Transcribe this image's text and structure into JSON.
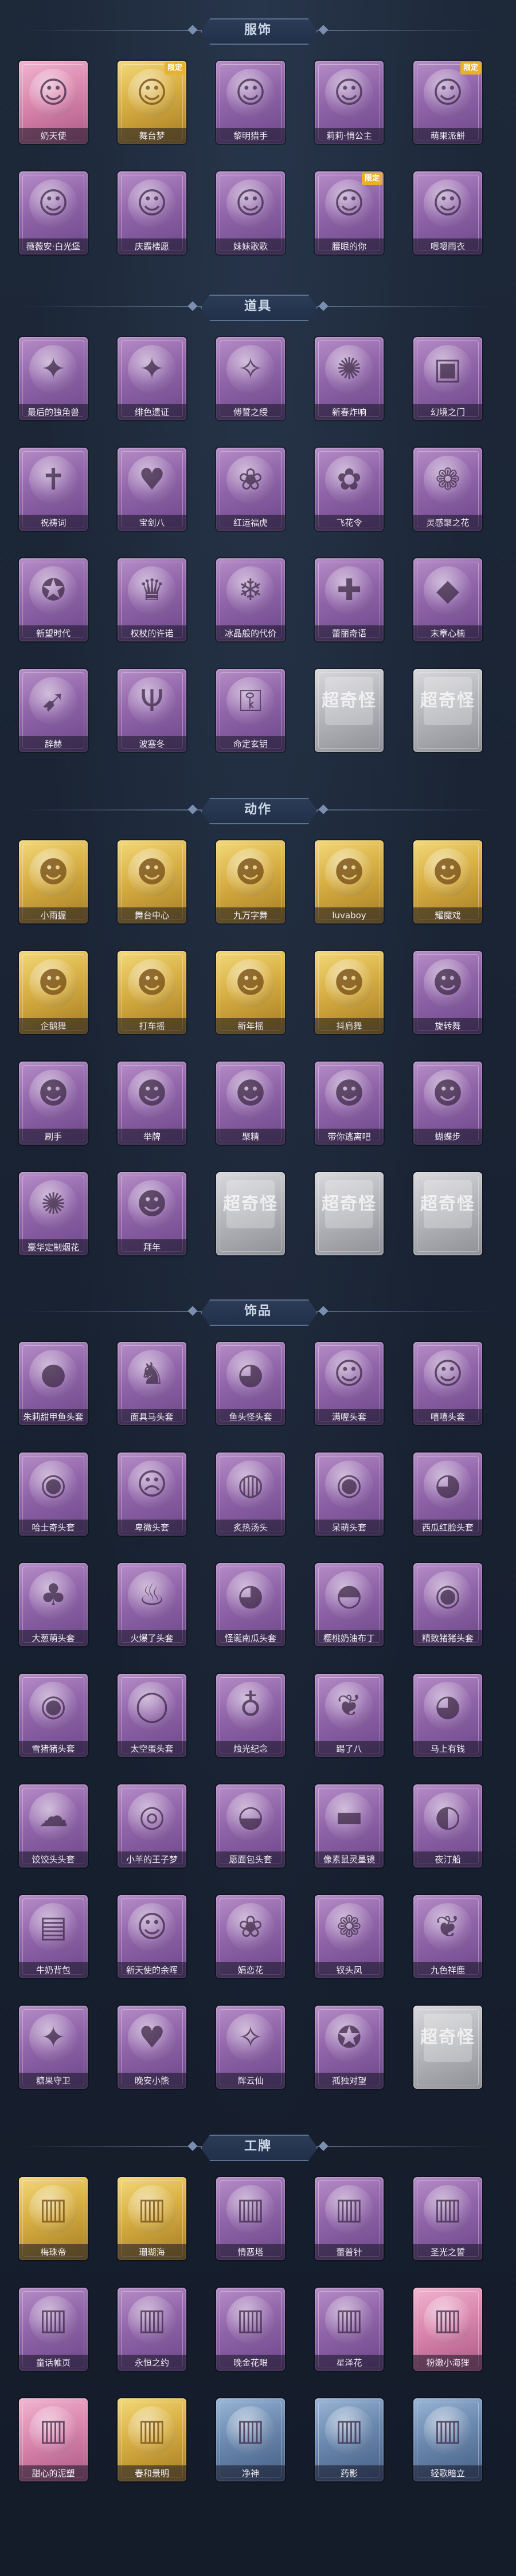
{
  "sections": [
    {
      "title": "服饰",
      "items": [
        {
          "label": "奶天使",
          "theme": "pink",
          "icon": "angel-portrait-icon",
          "glyph": "☺",
          "badge": ""
        },
        {
          "label": "舞台梦",
          "theme": "gold",
          "icon": "dancer-portrait-icon",
          "glyph": "☺",
          "badge": "限定"
        },
        {
          "label": "黎明猎手",
          "theme": "purple",
          "icon": "hunter-portrait-icon",
          "glyph": "☺",
          "badge": ""
        },
        {
          "label": "莉莉·悄公主",
          "theme": "purple",
          "icon": "princess-portrait-icon",
          "glyph": "☺",
          "badge": ""
        },
        {
          "label": "萌果派餅",
          "theme": "purple",
          "icon": "pie-portrait-icon",
          "glyph": "☺",
          "badge": "限定"
        },
        {
          "label": "薇薇安·白光堡",
          "theme": "purple",
          "icon": "castle-portrait-icon",
          "glyph": "☺",
          "badge": ""
        },
        {
          "label": "庆霸楼愿",
          "theme": "purple",
          "icon": "celebration-portrait-icon",
          "glyph": "☺",
          "badge": ""
        },
        {
          "label": "妹妹歌歌",
          "theme": "purple",
          "icon": "singer-portrait-icon",
          "glyph": "☺",
          "badge": ""
        },
        {
          "label": "腰眼的你",
          "theme": "purple",
          "icon": "witch-portrait-icon",
          "glyph": "☺",
          "badge": "限定"
        },
        {
          "label": "嗯嗯雨衣",
          "theme": "purple",
          "icon": "raincoat-portrait-icon",
          "glyph": "☺",
          "badge": ""
        }
      ]
    },
    {
      "title": "道具",
      "items": [
        {
          "label": "最后的独角兽",
          "theme": "purple",
          "icon": "unicorn-wand-icon",
          "glyph": "✦",
          "badge": ""
        },
        {
          "label": "绯色遗证",
          "theme": "purple",
          "icon": "scarlet-rod-icon",
          "glyph": "✦",
          "badge": ""
        },
        {
          "label": "傅誓之绶",
          "theme": "purple",
          "icon": "ribbon-icon",
          "glyph": "✧",
          "badge": ""
        },
        {
          "label": "新春炸响",
          "theme": "purple",
          "icon": "firecracker-icon",
          "glyph": "✺",
          "badge": ""
        },
        {
          "label": "幻境之门",
          "theme": "purple",
          "icon": "portal-icon",
          "glyph": "▣",
          "badge": ""
        },
        {
          "label": "祝祷词",
          "theme": "purple",
          "icon": "cross-staff-icon",
          "glyph": "✝",
          "badge": ""
        },
        {
          "label": "宝剑八",
          "theme": "purple",
          "icon": "heart-mirror-icon",
          "glyph": "♥",
          "badge": ""
        },
        {
          "label": "红运福虎",
          "theme": "purple",
          "icon": "tiger-lantern-icon",
          "glyph": "❀",
          "badge": ""
        },
        {
          "label": "飞花令",
          "theme": "purple",
          "icon": "flower-bouquet-icon",
          "glyph": "✿",
          "badge": ""
        },
        {
          "label": "灵感聚之花",
          "theme": "purple",
          "icon": "bloom-icon",
          "glyph": "❁",
          "badge": ""
        },
        {
          "label": "新望时代",
          "theme": "purple",
          "icon": "revolver-icon",
          "glyph": "✪",
          "badge": ""
        },
        {
          "label": "权杖的许诺",
          "theme": "purple",
          "icon": "scepter-icon",
          "glyph": "♛",
          "badge": ""
        },
        {
          "label": "冰晶般的代价",
          "theme": "purple",
          "icon": "ice-flower-icon",
          "glyph": "❄",
          "badge": ""
        },
        {
          "label": "蕾丽奇语",
          "theme": "purple",
          "icon": "medical-box-icon",
          "glyph": "✚",
          "badge": ""
        },
        {
          "label": "末章心楠",
          "theme": "purple",
          "icon": "lantern-icon",
          "glyph": "◆",
          "badge": ""
        },
        {
          "label": "辞赫",
          "theme": "purple",
          "icon": "spear-icon",
          "glyph": "➹",
          "badge": ""
        },
        {
          "label": "波塞冬",
          "theme": "purple",
          "icon": "trident-icon",
          "glyph": "Ψ",
          "badge": ""
        },
        {
          "label": "命定玄钥",
          "theme": "purple",
          "icon": "key-charm-icon",
          "glyph": "⚿",
          "badge": ""
        },
        {
          "label": "",
          "theme": "grey",
          "icon": "locked-placeholder-icon",
          "glyph": "超奇怪",
          "badge": ""
        },
        {
          "label": "",
          "theme": "grey",
          "icon": "locked-placeholder-icon",
          "glyph": "超奇怪",
          "badge": ""
        }
      ]
    },
    {
      "title": "动作",
      "items": [
        {
          "label": "小雨握",
          "theme": "gold",
          "icon": "emote-figure-icon",
          "glyph": "☻",
          "badge": ""
        },
        {
          "label": "舞台中心",
          "theme": "gold",
          "icon": "emote-figure-icon",
          "glyph": "☻",
          "badge": ""
        },
        {
          "label": "九万字舞",
          "theme": "gold",
          "icon": "emote-figure-icon",
          "glyph": "☻",
          "badge": ""
        },
        {
          "label": "luvaboy",
          "theme": "gold",
          "icon": "emote-figure-icon",
          "glyph": "☻",
          "badge": ""
        },
        {
          "label": "耀魔戏",
          "theme": "gold",
          "icon": "emote-figure-icon",
          "glyph": "☻",
          "badge": ""
        },
        {
          "label": "企鹅舞",
          "theme": "gold",
          "icon": "emote-figure-icon",
          "glyph": "☻",
          "badge": ""
        },
        {
          "label": "打车摇",
          "theme": "gold",
          "icon": "emote-figure-icon",
          "glyph": "☻",
          "badge": ""
        },
        {
          "label": "新年摇",
          "theme": "gold",
          "icon": "emote-figure-icon",
          "glyph": "☻",
          "badge": ""
        },
        {
          "label": "抖肩舞",
          "theme": "gold",
          "icon": "emote-figure-icon",
          "glyph": "☻",
          "badge": ""
        },
        {
          "label": "旋转舞",
          "theme": "purple",
          "icon": "emote-figure-icon",
          "glyph": "☻",
          "badge": ""
        },
        {
          "label": "刷手",
          "theme": "purple",
          "icon": "emote-figure-icon",
          "glyph": "☻",
          "badge": ""
        },
        {
          "label": "举牌",
          "theme": "purple",
          "icon": "emote-figure-icon",
          "glyph": "☻",
          "badge": ""
        },
        {
          "label": "聚精",
          "theme": "purple",
          "icon": "emote-figure-icon",
          "glyph": "☻",
          "badge": ""
        },
        {
          "label": "带你逃离吧",
          "theme": "purple",
          "icon": "emote-figure-icon",
          "glyph": "☻",
          "badge": ""
        },
        {
          "label": "蝴蝶步",
          "theme": "purple",
          "icon": "emote-figure-icon",
          "glyph": "☻",
          "badge": ""
        },
        {
          "label": "豪华定制烟花",
          "theme": "purple",
          "icon": "fireworks-icon",
          "glyph": "✺",
          "badge": ""
        },
        {
          "label": "拜年",
          "theme": "purple",
          "icon": "emote-figure-icon",
          "glyph": "☻",
          "badge": ""
        },
        {
          "label": "",
          "theme": "grey",
          "icon": "locked-placeholder-icon",
          "glyph": "超奇怪",
          "badge": ""
        },
        {
          "label": "",
          "theme": "grey",
          "icon": "locked-placeholder-icon",
          "glyph": "超奇怪",
          "badge": ""
        },
        {
          "label": "",
          "theme": "grey",
          "icon": "locked-placeholder-icon",
          "glyph": "超奇怪",
          "badge": ""
        }
      ]
    },
    {
      "title": "饰品",
      "items": [
        {
          "label": "朱莉甜甲鱼头套",
          "theme": "purple",
          "icon": "mask-head-icon",
          "glyph": "●",
          "badge": ""
        },
        {
          "label": "面具马头套",
          "theme": "purple",
          "icon": "horse-head-icon",
          "glyph": "♞",
          "badge": ""
        },
        {
          "label": "鱼头怪头套",
          "theme": "purple",
          "icon": "fish-head-icon",
          "glyph": "◕",
          "badge": ""
        },
        {
          "label": "满喔头套",
          "theme": "purple",
          "icon": "smiley-head-icon",
          "glyph": "☺",
          "badge": ""
        },
        {
          "label": "嘻嘻头套",
          "theme": "purple",
          "icon": "grin-head-icon",
          "glyph": "☺",
          "badge": ""
        },
        {
          "label": "哈士奇头套",
          "theme": "purple",
          "icon": "husky-head-icon",
          "glyph": "◉",
          "badge": ""
        },
        {
          "label": "卑微头套",
          "theme": "purple",
          "icon": "sad-head-icon",
          "glyph": "☹",
          "badge": ""
        },
        {
          "label": "炙热汤头",
          "theme": "purple",
          "icon": "hot-pot-head-icon",
          "glyph": "◍",
          "badge": ""
        },
        {
          "label": "呆萌头套",
          "theme": "purple",
          "icon": "dumb-face-head-icon",
          "glyph": "◉",
          "badge": ""
        },
        {
          "label": "西瓜红脸头套",
          "theme": "purple",
          "icon": "pikachu-head-icon",
          "glyph": "◕",
          "badge": ""
        },
        {
          "label": "大葱萌头套",
          "theme": "purple",
          "icon": "scallion-head-icon",
          "glyph": "♣",
          "badge": ""
        },
        {
          "label": "火爆了头套",
          "theme": "purple",
          "icon": "fire-head-icon",
          "glyph": "♨",
          "badge": ""
        },
        {
          "label": "怪诞南瓜头套",
          "theme": "purple",
          "icon": "pumpkin-head-icon",
          "glyph": "◕",
          "badge": ""
        },
        {
          "label": "樱桃奶油布丁",
          "theme": "purple",
          "icon": "pudding-head-icon",
          "glyph": "◓",
          "badge": ""
        },
        {
          "label": "精致猪猪头套",
          "theme": "purple",
          "icon": "pig-head-icon",
          "glyph": "◉",
          "badge": ""
        },
        {
          "label": "雪猪猪头套",
          "theme": "purple",
          "icon": "snow-pig-head-icon",
          "glyph": "◉",
          "badge": ""
        },
        {
          "label": "太空蛋头套",
          "theme": "purple",
          "icon": "egg-head-icon",
          "glyph": "◯",
          "badge": ""
        },
        {
          "label": "烛光纪念",
          "theme": "purple",
          "icon": "candle-head-icon",
          "glyph": "♁",
          "badge": ""
        },
        {
          "label": "踢了八",
          "theme": "purple",
          "icon": "garlic-head-icon",
          "glyph": "❦",
          "badge": ""
        },
        {
          "label": "马上有钱",
          "theme": "purple",
          "icon": "lucky-head-icon",
          "glyph": "◕",
          "badge": ""
        },
        {
          "label": "饺饺头头套",
          "theme": "purple",
          "icon": "dumpling-head-icon",
          "glyph": "☁",
          "badge": ""
        },
        {
          "label": "小羊的王子梦",
          "theme": "purple",
          "icon": "lamb-head-icon",
          "glyph": "◎",
          "badge": ""
        },
        {
          "label": "愿面包头套",
          "theme": "purple",
          "icon": "bread-head-icon",
          "glyph": "◒",
          "badge": ""
        },
        {
          "label": "像素鼠灵墨镜",
          "theme": "purple",
          "icon": "pixel-sunglasses-icon",
          "glyph": "▬",
          "badge": ""
        },
        {
          "label": "夜汀船",
          "theme": "purple",
          "icon": "night-boat-icon",
          "glyph": "◐",
          "badge": ""
        },
        {
          "label": "牛奶背包",
          "theme": "purple",
          "icon": "milk-backpack-icon",
          "glyph": "▤",
          "badge": ""
        },
        {
          "label": "新天使的余晖",
          "theme": "purple",
          "icon": "angel-doll-icon",
          "glyph": "☺",
          "badge": ""
        },
        {
          "label": "娟恋花",
          "theme": "purple",
          "icon": "flower-pendant-icon",
          "glyph": "❀",
          "badge": ""
        },
        {
          "label": "钗头凤",
          "theme": "purple",
          "icon": "phoenix-hairpin-icon",
          "glyph": "❁",
          "badge": ""
        },
        {
          "label": "九色祥鹿",
          "theme": "purple",
          "icon": "deer-ornament-icon",
          "glyph": "❦",
          "badge": ""
        },
        {
          "label": "糖果守卫",
          "theme": "purple",
          "icon": "candy-guard-icon",
          "glyph": "✦",
          "badge": ""
        },
        {
          "label": "晚安小熊",
          "theme": "purple",
          "icon": "bear-doll-icon",
          "glyph": "♥",
          "badge": ""
        },
        {
          "label": "辉云仙",
          "theme": "purple",
          "icon": "cloud-fairy-icon",
          "glyph": "✧",
          "badge": ""
        },
        {
          "label": "孤独对望",
          "theme": "purple",
          "icon": "lonely-charm-icon",
          "glyph": "✪",
          "badge": ""
        },
        {
          "label": "",
          "theme": "grey",
          "icon": "locked-placeholder-icon",
          "glyph": "超奇怪",
          "badge": ""
        }
      ]
    },
    {
      "title": "工牌",
      "items": [
        {
          "label": "梅珠帝",
          "theme": "gold",
          "icon": "badge-card-icon",
          "glyph": "▥",
          "badge": ""
        },
        {
          "label": "珊瑚海",
          "theme": "gold",
          "icon": "badge-card-icon",
          "glyph": "▥",
          "badge": ""
        },
        {
          "label": "情恶塔",
          "theme": "purple",
          "icon": "badge-card-icon",
          "glyph": "▥",
          "badge": ""
        },
        {
          "label": "蕾普针",
          "theme": "purple",
          "icon": "badge-card-icon",
          "glyph": "▥",
          "badge": ""
        },
        {
          "label": "圣光之誓",
          "theme": "purple",
          "icon": "badge-card-icon",
          "glyph": "▥",
          "badge": ""
        },
        {
          "label": "童话帷页",
          "theme": "purple",
          "icon": "badge-card-icon",
          "glyph": "▥",
          "badge": ""
        },
        {
          "label": "永恒之约",
          "theme": "purple",
          "icon": "badge-card-icon",
          "glyph": "▥",
          "badge": ""
        },
        {
          "label": "晚金花眼",
          "theme": "purple",
          "icon": "badge-card-icon",
          "glyph": "▥",
          "badge": ""
        },
        {
          "label": "星泽花",
          "theme": "purple",
          "icon": "badge-card-icon",
          "glyph": "▥",
          "badge": ""
        },
        {
          "label": "粉嫩小海狸",
          "theme": "pink",
          "icon": "badge-card-icon",
          "glyph": "▥",
          "badge": ""
        },
        {
          "label": "甜心的泥塑",
          "theme": "pink",
          "icon": "badge-card-icon",
          "glyph": "▥",
          "badge": ""
        },
        {
          "label": "春和景明",
          "theme": "gold",
          "icon": "badge-card-icon",
          "glyph": "▥",
          "badge": ""
        },
        {
          "label": "净神",
          "theme": "blue",
          "icon": "badge-card-icon",
          "glyph": "▥",
          "badge": ""
        },
        {
          "label": "药影",
          "theme": "blue",
          "icon": "badge-card-icon",
          "glyph": "▥",
          "badge": ""
        },
        {
          "label": "轻歌暗立",
          "theme": "blue",
          "icon": "badge-card-icon",
          "glyph": "▥",
          "badge": ""
        }
      ]
    }
  ]
}
